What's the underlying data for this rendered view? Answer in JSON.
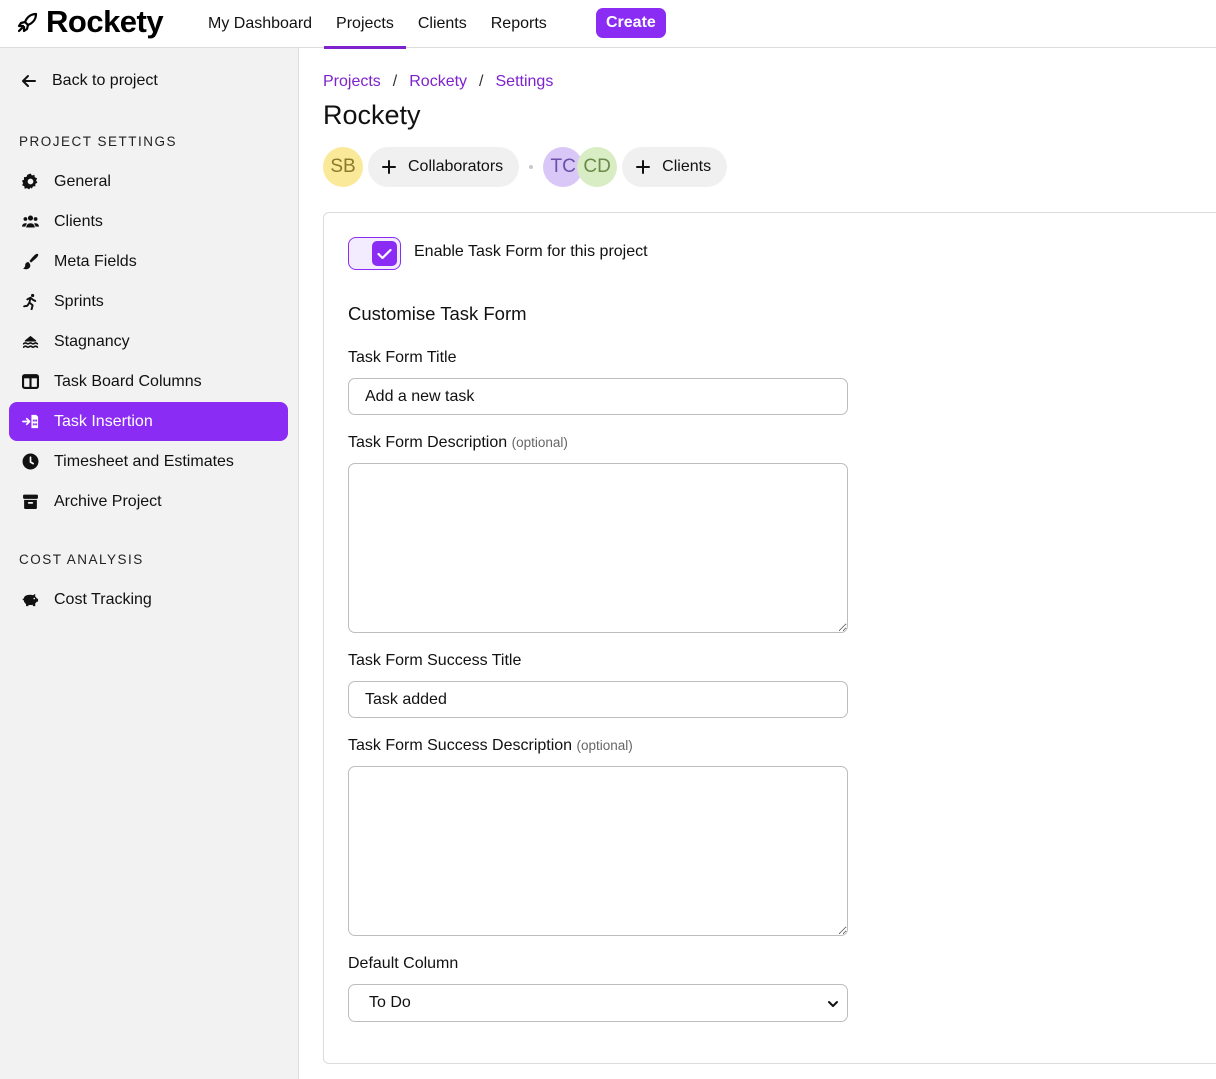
{
  "app": {
    "name": "Rockety"
  },
  "topnav": {
    "items": [
      {
        "label": "My Dashboard"
      },
      {
        "label": "Projects",
        "active": true
      },
      {
        "label": "Clients"
      },
      {
        "label": "Reports"
      }
    ],
    "create_label": "Create"
  },
  "sidebar": {
    "back_label": "Back to project",
    "project_settings_title": "PROJECT SETTINGS",
    "items": [
      {
        "label": "General",
        "icon": "gear-icon"
      },
      {
        "label": "Clients",
        "icon": "users-icon"
      },
      {
        "label": "Meta Fields",
        "icon": "brush-icon"
      },
      {
        "label": "Sprints",
        "icon": "running-icon"
      },
      {
        "label": "Stagnancy",
        "icon": "water-icon"
      },
      {
        "label": "Task Board Columns",
        "icon": "columns-icon"
      },
      {
        "label": "Task Insertion",
        "icon": "insert-icon",
        "active": true
      },
      {
        "label": "Timesheet and Estimates",
        "icon": "clock-icon"
      },
      {
        "label": "Archive Project",
        "icon": "archive-icon"
      }
    ],
    "cost_analysis_title": "COST ANALYSIS",
    "cost_items": [
      {
        "label": "Cost Tracking",
        "icon": "piggy-bank-icon"
      }
    ]
  },
  "breadcrumb": [
    "Projects",
    "Rockety",
    "Settings"
  ],
  "page_title": "Rockety",
  "people": {
    "collaborators": [
      {
        "initials": "SB",
        "bg": "#fbe99a",
        "fg": "#8a7a2a"
      }
    ],
    "collaborators_label": "Collaborators",
    "clients": [
      {
        "initials": "TC",
        "bg": "#d9c7f7",
        "fg": "#6b4fa8"
      },
      {
        "initials": "CD",
        "bg": "#d9edc4",
        "fg": "#6b8a4a"
      }
    ],
    "clients_label": "Clients"
  },
  "form": {
    "enable_label": "Enable Task Form for this project",
    "enabled": true,
    "heading": "Customise Task Form",
    "title_label": "Task Form Title",
    "title_value": "Add a new task",
    "description_label": "Task Form Description",
    "optional_text": "(optional)",
    "description_value": "",
    "success_title_label": "Task Form Success Title",
    "success_title_value": "Task added",
    "success_description_label": "Task Form Success Description",
    "success_description_value": "",
    "default_column_label": "Default Column",
    "default_column_value": "To Do"
  },
  "colors": {
    "accent": "#8b2cf5",
    "link": "#7e22ce"
  }
}
